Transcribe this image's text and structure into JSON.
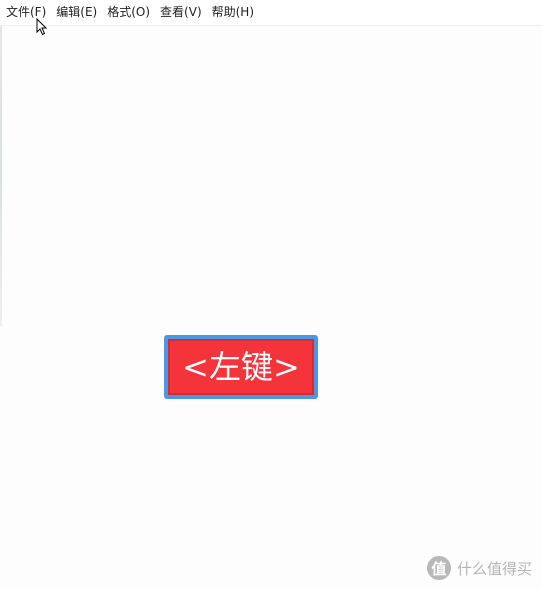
{
  "menubar": {
    "items": [
      {
        "label": "文件(F)"
      },
      {
        "label": "编辑(E)"
      },
      {
        "label": "格式(O)"
      },
      {
        "label": "查看(V)"
      },
      {
        "label": "帮助(H)"
      }
    ]
  },
  "overlay": {
    "key_label": "<左键>",
    "badge_fill": "#f5333b",
    "badge_border": "#4a97e6"
  },
  "watermark": {
    "logo_glyph": "值",
    "text": "什么值得买"
  },
  "icons": {
    "cursor": "mouse-pointer-icon"
  }
}
